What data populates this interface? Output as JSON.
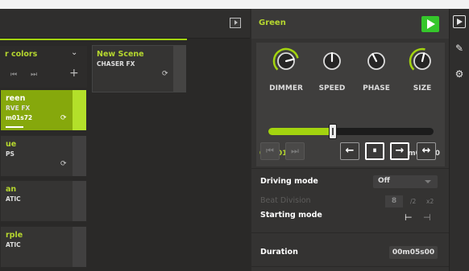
{
  "left": {
    "group": {
      "name": "r colors",
      "chevron_icon": "chevron-down-icon",
      "controls": [
        "skip-back-icon",
        "skip-forward-icon"
      ],
      "add_icon": "plus-icon"
    },
    "scene_card": {
      "title": "New Scene",
      "type": "CHASER FX",
      "loop_icon": "loop-icon"
    },
    "fx_cards": [
      {
        "title": "reen",
        "type": "RVE FX",
        "time": "m01s72",
        "active": true,
        "loop_icon": "loop-icon"
      },
      {
        "title": "ue",
        "type": "PS",
        "loop_icon": "loop-icon"
      },
      {
        "title": "an",
        "type": "ATIC"
      },
      {
        "title": "rple",
        "type": "ATIC"
      }
    ]
  },
  "right": {
    "title": "Green",
    "play_icon": "play-icon",
    "knobs": [
      {
        "label": "DIMMER",
        "level": 0.78,
        "ring": true
      },
      {
        "label": "SPEED",
        "level": 0.5,
        "ring": false
      },
      {
        "label": "PHASE",
        "level": 0.4,
        "ring": false
      },
      {
        "label": "SIZE",
        "level": 0.55,
        "ring": true
      }
    ],
    "position_slider": {
      "value_fraction": 0.39
    },
    "time_elapsed": "00m01s72",
    "time_total": "00m05s00",
    "transport_buttons": [
      "skip-back-icon",
      "skip-forward-icon"
    ],
    "direction_buttons": [
      {
        "icon": "arrow-left-icon",
        "glyph": "←"
      },
      {
        "icon": "pause-icon",
        "glyph": "⏸",
        "selected": true
      },
      {
        "icon": "arrow-right-icon",
        "glyph": "→",
        "selected": true
      },
      {
        "icon": "arrow-bounce-icon",
        "glyph": "↔"
      }
    ],
    "driving_mode": {
      "label": "Driving mode",
      "value": "Off"
    },
    "beat_division": {
      "label": "Beat Division",
      "value": "8",
      "ops": [
        "/2",
        "x2"
      ]
    },
    "starting_mode": {
      "label": "Starting mode"
    },
    "duration": {
      "label": "Duration",
      "value": "00m05s00"
    }
  },
  "sidebar": {
    "icons": [
      "play-box-icon",
      "pencil-icon",
      "gear-icon"
    ]
  },
  "colors": {
    "accent": "#a3d40f",
    "play_green": "#35c72b"
  }
}
